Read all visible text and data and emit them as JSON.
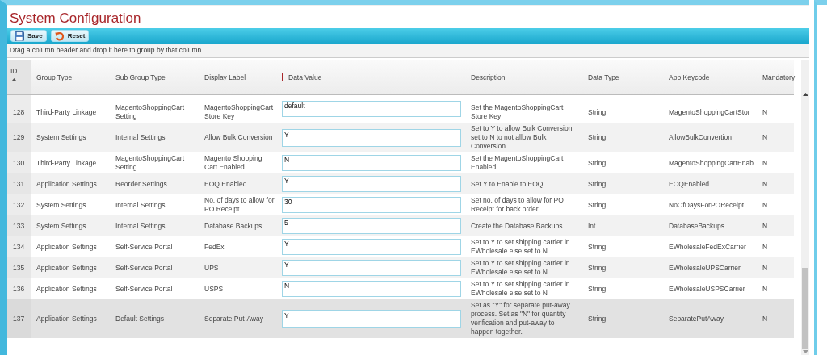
{
  "window": {
    "title": "System Configuration"
  },
  "toolbar": {
    "buttons": [
      {
        "kind": "save",
        "label": "Save"
      },
      {
        "kind": "reset",
        "label": "Reset"
      }
    ]
  },
  "group_panel": {
    "hint": "Drag a column header and drop it here to group by that column"
  },
  "table": {
    "columns": [
      {
        "label": "ID",
        "sorted": true
      },
      {
        "label": "Group Type",
        "sorted": false
      },
      {
        "label": "Sub Group Type",
        "sorted": false
      },
      {
        "label": "Display Label",
        "sorted": false
      },
      {
        "label": "Data Value",
        "sorted": false
      },
      {
        "label": "Description",
        "sorted": false
      },
      {
        "label": "Data Type",
        "sorted": false
      },
      {
        "label": "App Keycode",
        "sorted": false
      },
      {
        "label": "Mandatory",
        "sorted": false
      }
    ],
    "rows": [
      {
        "id": "128",
        "group": "Third-Party Linkage",
        "sub_group": "MagentoShoppingCart Setting",
        "label": "MagentoShoppingCart Store Key",
        "value": "default",
        "description": "Set the MagentoShoppingCart Store Key",
        "data_type": "String",
        "keycode": "MagentoShoppingCartStor",
        "mandatory": "N",
        "selected": false
      },
      {
        "id": "129",
        "group": "System Settings",
        "sub_group": "Internal Settings",
        "label": "Allow Bulk Conversion",
        "value": "Y",
        "description": "Set to Y to allow Bulk Conversion, set to N to not allow Bulk Conversion",
        "data_type": "String",
        "keycode": "AllowBulkConvertion",
        "mandatory": "N",
        "selected": false
      },
      {
        "id": "130",
        "group": "Third-Party Linkage",
        "sub_group": "MagentoShoppingCart Setting",
        "label": "Magento Shopping Cart Enabled",
        "value": "N",
        "description": "Set the MagentoShoppingCart Enabled",
        "data_type": "String",
        "keycode": "MagentoShoppingCartEnab",
        "mandatory": "N",
        "selected": false
      },
      {
        "id": "131",
        "group": "Application Settings",
        "sub_group": "Reorder Settings",
        "label": "EOQ Enabled",
        "value": "Y",
        "description": "Set Y to Enable to EOQ",
        "data_type": "String",
        "keycode": "EOQEnabled",
        "mandatory": "N",
        "selected": false
      },
      {
        "id": "132",
        "group": "System Settings",
        "sub_group": "Internal Settings",
        "label": "No. of days to allow for PO Receipt",
        "value": "30",
        "description": "Set no. of days to allow for PO Receipt for back order",
        "data_type": "String",
        "keycode": "NoOfDaysForPOReceipt",
        "mandatory": "N",
        "selected": false
      },
      {
        "id": "133",
        "group": "System Settings",
        "sub_group": "Internal Settings",
        "label": "Database Backups",
        "value": "5",
        "description": "Create the Database Backups",
        "data_type": "Int",
        "keycode": "DatabaseBackups",
        "mandatory": "N",
        "selected": false
      },
      {
        "id": "134",
        "group": "Application Settings",
        "sub_group": "Self-Service Portal",
        "label": "FedEx",
        "value": "Y",
        "description": "Set to Y to set shipping carrier in EWholesale else set to N",
        "data_type": "String",
        "keycode": "EWholesaleFedExCarrier",
        "mandatory": "N",
        "selected": false
      },
      {
        "id": "135",
        "group": "Application Settings",
        "sub_group": "Self-Service Portal",
        "label": "UPS",
        "value": "Y",
        "description": "Set to Y to set shipping carrier in EWholesale else set to N",
        "data_type": "String",
        "keycode": "EWholesaleUPSCarrier",
        "mandatory": "N",
        "selected": false
      },
      {
        "id": "136",
        "group": "Application Settings",
        "sub_group": "Self-Service Portal",
        "label": "USPS",
        "value": "N",
        "description": "Set to Y to set shipping carrier in EWholesale else set to N",
        "data_type": "String",
        "keycode": "EWholesaleUSPSCarrier",
        "mandatory": "N",
        "selected": false
      },
      {
        "id": "137",
        "group": "Application Settings",
        "sub_group": "Default Settings",
        "label": "Separate Put-Away",
        "value": "Y",
        "description": "Set as \"Y\" for separate put-away process. Set as \"N\" for quantity verification and put-away to happen together.",
        "data_type": "String",
        "keycode": "SeparatePutAway",
        "mandatory": "N",
        "selected": true
      }
    ]
  }
}
